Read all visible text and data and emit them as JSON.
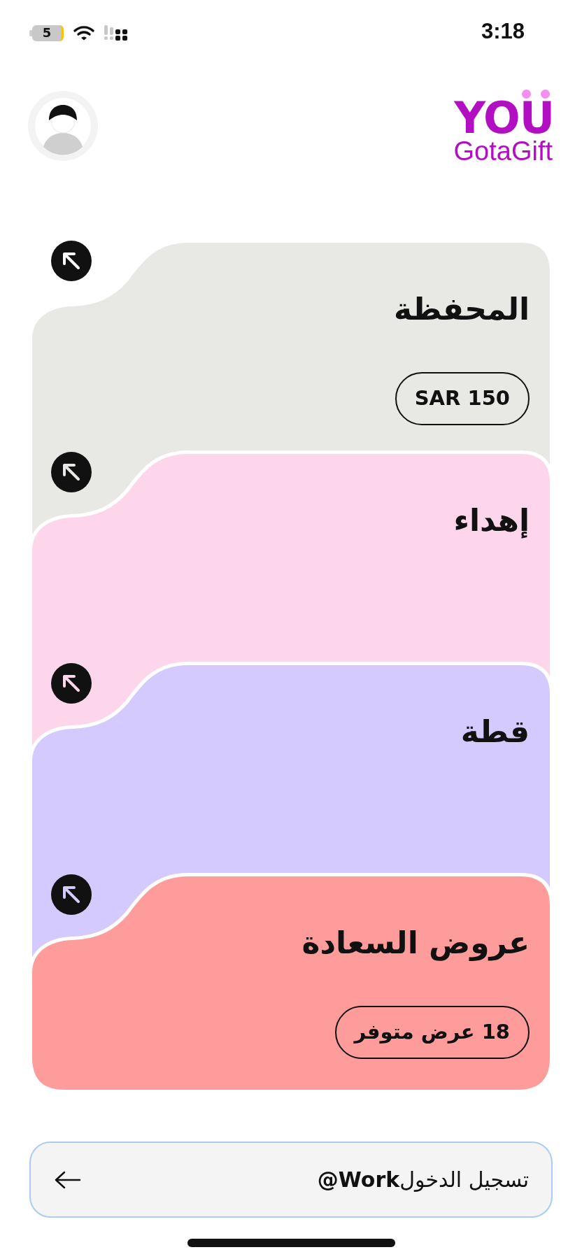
{
  "status_bar": {
    "battery": "5",
    "time": "3:18"
  },
  "header": {
    "logo": {
      "wordmark": "YOU",
      "tagline": "GotaGift"
    }
  },
  "cards": [
    {
      "title": "المحفظة",
      "badge": "SAR 150",
      "color": "#e8e9e5"
    },
    {
      "title": "إهداء",
      "color": "#fdd6ec"
    },
    {
      "title": "قطة",
      "color": "#d4cafd"
    },
    {
      "title": "عروض السعادة",
      "badge": "18 عرض متوفر",
      "color": "#fe9c9c"
    }
  ],
  "login_button": {
    "label": "تسجيل الدخول**Work@**"
  }
}
